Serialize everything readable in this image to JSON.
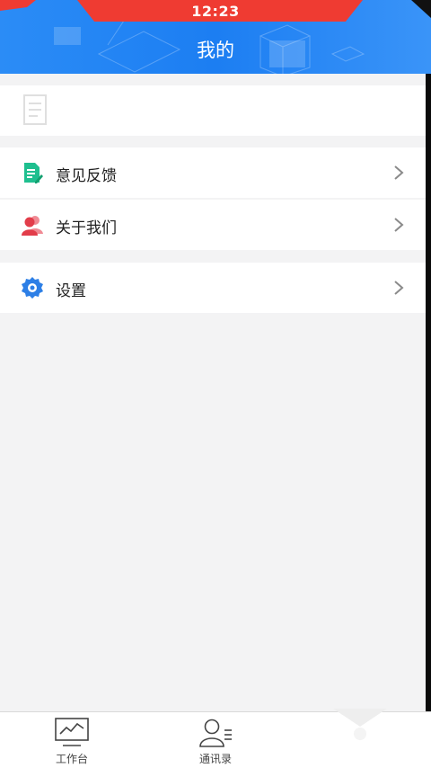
{
  "status_bar": {
    "time": "12:23"
  },
  "header": {
    "title": "我的"
  },
  "menu": {
    "feedback": {
      "label": "意见反馈",
      "icon": "feedback-icon"
    },
    "about": {
      "label": "关于我们",
      "icon": "people-icon"
    },
    "settings": {
      "label": "设置",
      "icon": "gear-icon"
    }
  },
  "bottom_nav": {
    "workbench": {
      "label": "工作台",
      "icon": "monitor-chart-icon"
    },
    "contacts": {
      "label": "通讯录",
      "icon": "contact-person-icon"
    }
  },
  "colors": {
    "header_blue": "#1c7ef2",
    "status_red": "#ef3b32",
    "feedback_green": "#1fbf8f",
    "about_red": "#e23d4a",
    "settings_blue": "#2d7fe6"
  }
}
